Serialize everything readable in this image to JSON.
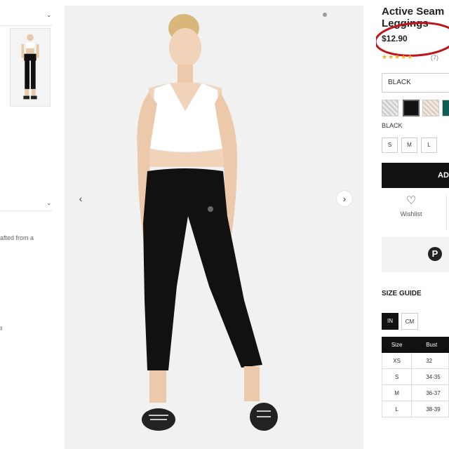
{
  "left_panel": {
    "description_snippet": "afted from a",
    "misc_mark": "ll"
  },
  "product": {
    "title_line1": "Active Seam",
    "title_line2": "Leggings",
    "price": "$12.90",
    "rating_stars": "★★★★★",
    "review_count": "(7)",
    "color_selected": "BLACK",
    "swatch_label": "BLACK",
    "sizes": [
      "S",
      "M",
      "L"
    ],
    "add_button_label": "AD",
    "wishlist_label": "Wishlist",
    "pinterest_glyph": "P"
  },
  "colors": {
    "swatch_black": "#111111",
    "swatch_green": "#0f5e52",
    "accent_red": "#c0141c"
  },
  "size_guide": {
    "title": "SIZE GUIDE",
    "unit_in": "IN",
    "unit_cm": "CM",
    "headers": [
      "Size",
      "Bust"
    ],
    "rows": [
      [
        "XS",
        "32"
      ],
      [
        "S",
        "34-35"
      ],
      [
        "M",
        "36-37"
      ],
      [
        "L",
        "38-39"
      ]
    ]
  },
  "gallery": {
    "prev_glyph": "‹",
    "next_glyph": "›"
  }
}
